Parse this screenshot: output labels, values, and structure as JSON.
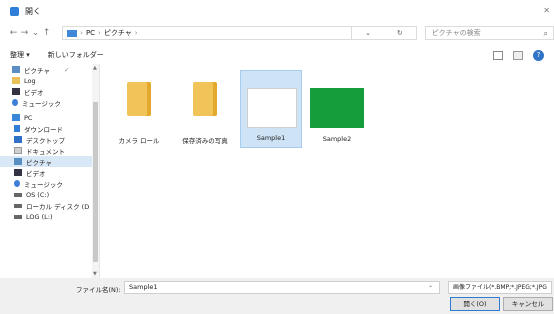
{
  "window": {
    "title": "開く",
    "close": "✕"
  },
  "nav": {
    "back": "←",
    "forward": "→",
    "recent": "⌄",
    "up": "↑",
    "path": [
      "PC",
      "ピクチャ"
    ],
    "refresh": "↻",
    "search_placeholder": "ピクチャの検索"
  },
  "toolbar": {
    "organize": "整理 ▾",
    "new_folder": "新しいフォルダー"
  },
  "sidebar": {
    "items": [
      {
        "label": "ピクチャ",
        "icon": "pictures-icon"
      },
      {
        "label": "Log",
        "icon": "folder-icon"
      },
      {
        "label": "ビデオ",
        "icon": "video-icon"
      },
      {
        "label": "ミュージック",
        "icon": "music-icon"
      },
      {
        "label": "PC",
        "icon": "pc-icon"
      },
      {
        "label": "ダウンロード",
        "icon": "download-icon"
      },
      {
        "label": "デスクトップ",
        "icon": "desktop-icon"
      },
      {
        "label": "ドキュメント",
        "icon": "documents-icon"
      },
      {
        "label": "ピクチャ",
        "icon": "pictures-icon"
      },
      {
        "label": "ビデオ",
        "icon": "video-icon"
      },
      {
        "label": "ミュージック",
        "icon": "music-icon"
      },
      {
        "label": "OS (C:)",
        "icon": "drive-icon"
      },
      {
        "label": "ローカル ディスク (D",
        "icon": "drive-icon"
      },
      {
        "label": "LOG (L:)",
        "icon": "drive-icon"
      }
    ]
  },
  "files": [
    {
      "label": "カメラ ロール",
      "type": "folder"
    },
    {
      "label": "保存済みの写真",
      "type": "folder"
    },
    {
      "label": "Sample1",
      "type": "image-white",
      "selected": true
    },
    {
      "label": "Sample2",
      "type": "image-green"
    }
  ],
  "bottom": {
    "filename_label": "ファイル名(N):",
    "filename_value": "Sample1",
    "filetype": "画像ファイル(*.BMP;*.JPEG;*.JPG",
    "open": "開く(O)",
    "cancel": "キャンセル"
  },
  "colors": {
    "accent": "#2f7fd8",
    "selection": "#cfe3f6",
    "green_image": "#159c3b",
    "folder": "#f1c45a"
  }
}
